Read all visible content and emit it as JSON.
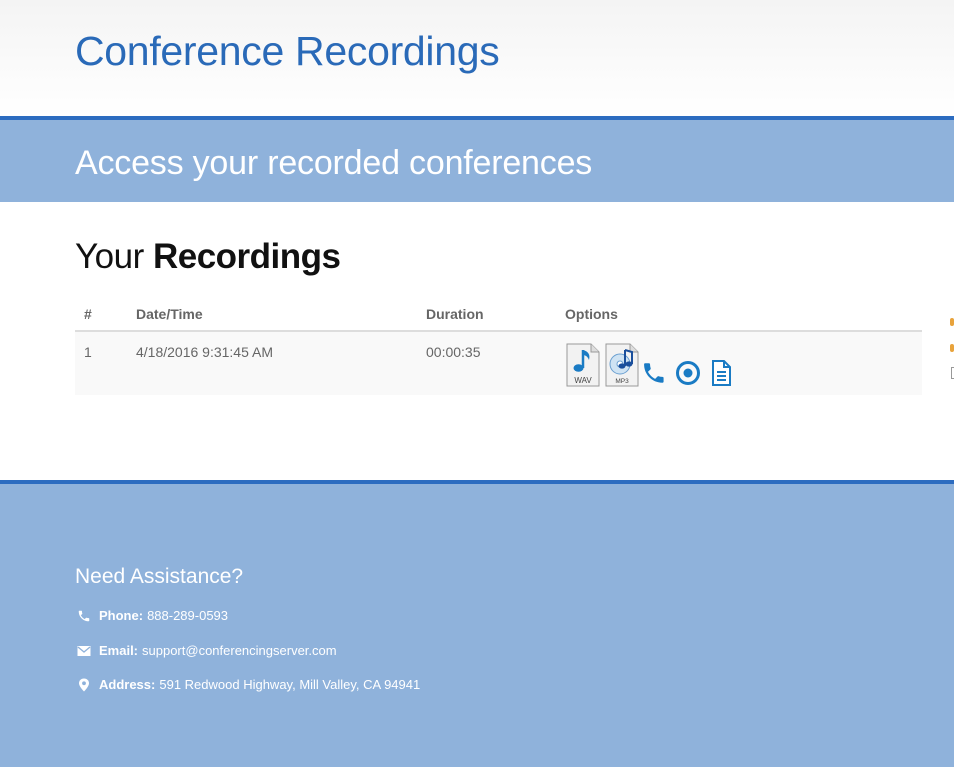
{
  "header": {
    "title": "Conference Recordings"
  },
  "banner": {
    "subtitle": "Access your recorded conferences"
  },
  "section": {
    "title_prefix": "Your",
    "title_bold": "Recordings"
  },
  "table": {
    "columns": [
      "#",
      "Date/Time",
      "Duration",
      "Options"
    ],
    "rows": [
      {
        "num": "1",
        "datetime": "4/18/2016 9:31:45 AM",
        "duration": "00:00:35",
        "options": [
          {
            "icon": "wav-file-icon",
            "label": "WAV"
          },
          {
            "icon": "mp3-file-icon",
            "label": "MP3"
          },
          {
            "icon": "phone-icon"
          },
          {
            "icon": "record-icon"
          },
          {
            "icon": "document-icon"
          }
        ]
      }
    ]
  },
  "footer": {
    "heading": "Need Assistance?",
    "phone_label": "Phone:",
    "phone": "888-289-0593",
    "email_label": "Email:",
    "email": "support@conferencingserver.com",
    "address_label": "Address:",
    "address": "591 Redwood Highway, Mill Valley, CA 94941"
  },
  "colors": {
    "accent": "#2a6ab8",
    "band": "#8fb2db",
    "border": "#2c6cc0",
    "icon": "#1a7bc4"
  }
}
